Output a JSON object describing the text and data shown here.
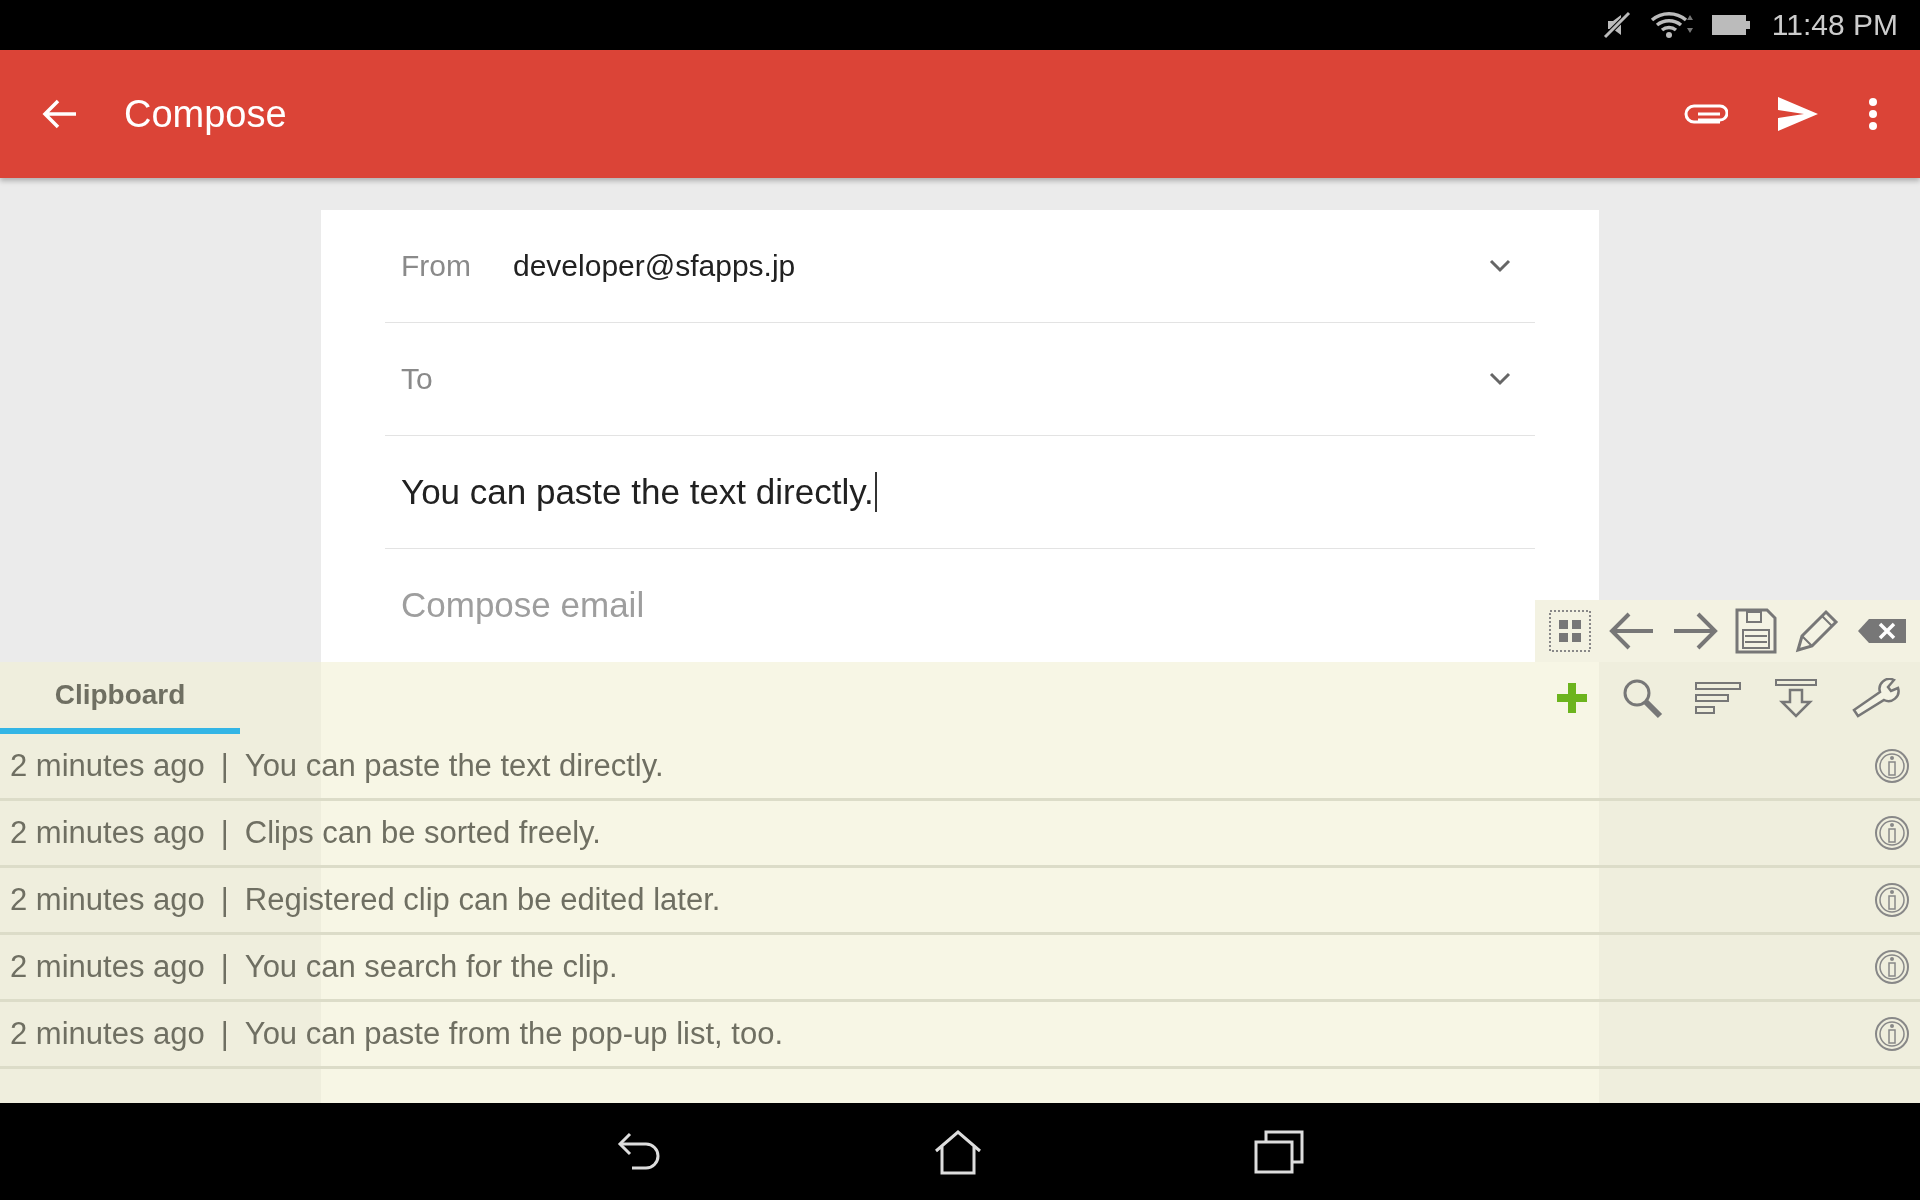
{
  "status_bar": {
    "time": "11:48 PM"
  },
  "app_bar": {
    "title": "Compose"
  },
  "compose": {
    "from_label": "From",
    "from_value": "developer@sfapps.jp",
    "to_label": "To",
    "subject_value": "You can paste the text directly.",
    "body_placeholder": "Compose email"
  },
  "clipboard": {
    "tabs": [
      {
        "label": "Clipboard",
        "selected": true
      }
    ],
    "clips": [
      {
        "time": "2 minutes ago",
        "separator": "|",
        "text": "You can paste the text directly."
      },
      {
        "time": "2 minutes ago",
        "separator": "|",
        "text": "Clips can be sorted freely."
      },
      {
        "time": "2 minutes ago",
        "separator": "|",
        "text": "Registered clip can be edited later."
      },
      {
        "time": "2 minutes ago",
        "separator": "|",
        "text": "You can search for the clip."
      },
      {
        "time": "2 minutes ago",
        "separator": "|",
        "text": "You can paste from the pop-up list, too."
      }
    ]
  }
}
